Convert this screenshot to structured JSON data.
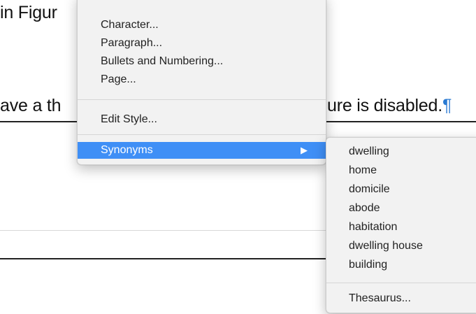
{
  "document": {
    "line1": "in Figur",
    "line2_left": "ave a th",
    "line2_right": "ure is disabled.",
    "pilcrow": "¶"
  },
  "context_menu": {
    "items": [
      {
        "label": "Character..."
      },
      {
        "label": "Paragraph..."
      },
      {
        "label": "Bullets and Numbering..."
      },
      {
        "label": "Page..."
      },
      {
        "label": "Edit Style..."
      },
      {
        "label": "Synonyms",
        "highlighted": true,
        "submenu_arrow": "▶"
      }
    ]
  },
  "synonyms_submenu": {
    "items": [
      {
        "label": "dwelling"
      },
      {
        "label": "home"
      },
      {
        "label": "domicile"
      },
      {
        "label": "abode"
      },
      {
        "label": "habitation"
      },
      {
        "label": "dwelling house"
      },
      {
        "label": "building"
      },
      {
        "label": "Thesaurus..."
      }
    ]
  },
  "colors": {
    "highlight": "#3f8ff6",
    "pilcrow": "#2a7ad2"
  }
}
